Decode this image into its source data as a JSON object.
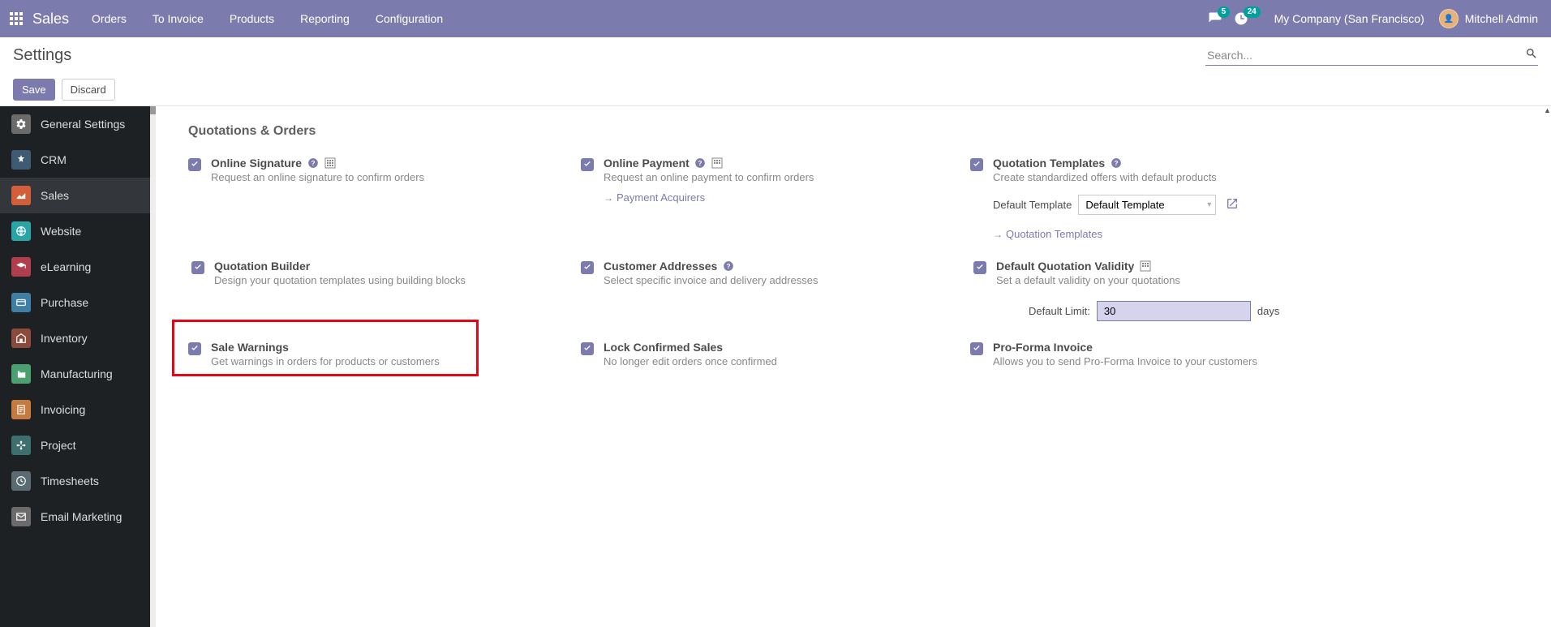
{
  "topnav": {
    "app_title": "Sales",
    "menu": [
      "Orders",
      "To Invoice",
      "Products",
      "Reporting",
      "Configuration"
    ],
    "chat_count": "5",
    "activity_count": "24",
    "company": "My Company (San Francisco)",
    "user": "Mitchell Admin"
  },
  "control_panel": {
    "title": "Settings",
    "search_placeholder": "Search...",
    "save": "Save",
    "discard": "Discard"
  },
  "sidebar": [
    {
      "name": "general",
      "label": "General Settings",
      "color": "#6b6b6b"
    },
    {
      "name": "crm",
      "label": "CRM",
      "color": "#3f5a73"
    },
    {
      "name": "sales",
      "label": "Sales",
      "color": "#d35f3a",
      "active": true
    },
    {
      "name": "website",
      "label": "Website",
      "color": "#2aa4a4"
    },
    {
      "name": "elearning",
      "label": "eLearning",
      "color": "#b13e4f"
    },
    {
      "name": "purchase",
      "label": "Purchase",
      "color": "#3f7fa6"
    },
    {
      "name": "inventory",
      "label": "Inventory",
      "color": "#8a4a3c"
    },
    {
      "name": "manufacturing",
      "label": "Manufacturing",
      "color": "#4aa06e"
    },
    {
      "name": "invoicing",
      "label": "Invoicing",
      "color": "#c77a3f"
    },
    {
      "name": "project",
      "label": "Project",
      "color": "#3d6f6f"
    },
    {
      "name": "timesheets",
      "label": "Timesheets",
      "color": "#5a6b72"
    },
    {
      "name": "email_marketing",
      "label": "Email Marketing",
      "color": "#6b6b6b"
    }
  ],
  "section": {
    "title": "Quotations & Orders"
  },
  "settings": {
    "online_signature": {
      "label": "Online Signature",
      "desc": "Request an online signature to confirm orders"
    },
    "online_payment": {
      "label": "Online Payment",
      "desc": "Request an online payment to confirm orders",
      "link": "Payment Acquirers"
    },
    "quotation_templates": {
      "label": "Quotation Templates",
      "desc": "Create standardized offers with default products",
      "field_label": "Default Template",
      "field_value": "Default Template",
      "link": "Quotation Templates"
    },
    "quotation_builder": {
      "label": "Quotation Builder",
      "desc": "Design your quotation templates using building blocks"
    },
    "customer_addresses": {
      "label": "Customer Addresses",
      "desc": "Select specific invoice and delivery addresses"
    },
    "default_validity": {
      "label": "Default Quotation Validity",
      "desc": "Set a default validity on your quotations",
      "field_label": "Default Limit:",
      "field_value": "30",
      "unit": "days"
    },
    "sale_warnings": {
      "label": "Sale Warnings",
      "desc": "Get warnings in orders for products or customers"
    },
    "lock_confirmed": {
      "label": "Lock Confirmed Sales",
      "desc": "No longer edit orders once confirmed"
    },
    "proforma": {
      "label": "Pro-Forma Invoice",
      "desc": "Allows you to send Pro-Forma Invoice to your customers"
    }
  }
}
